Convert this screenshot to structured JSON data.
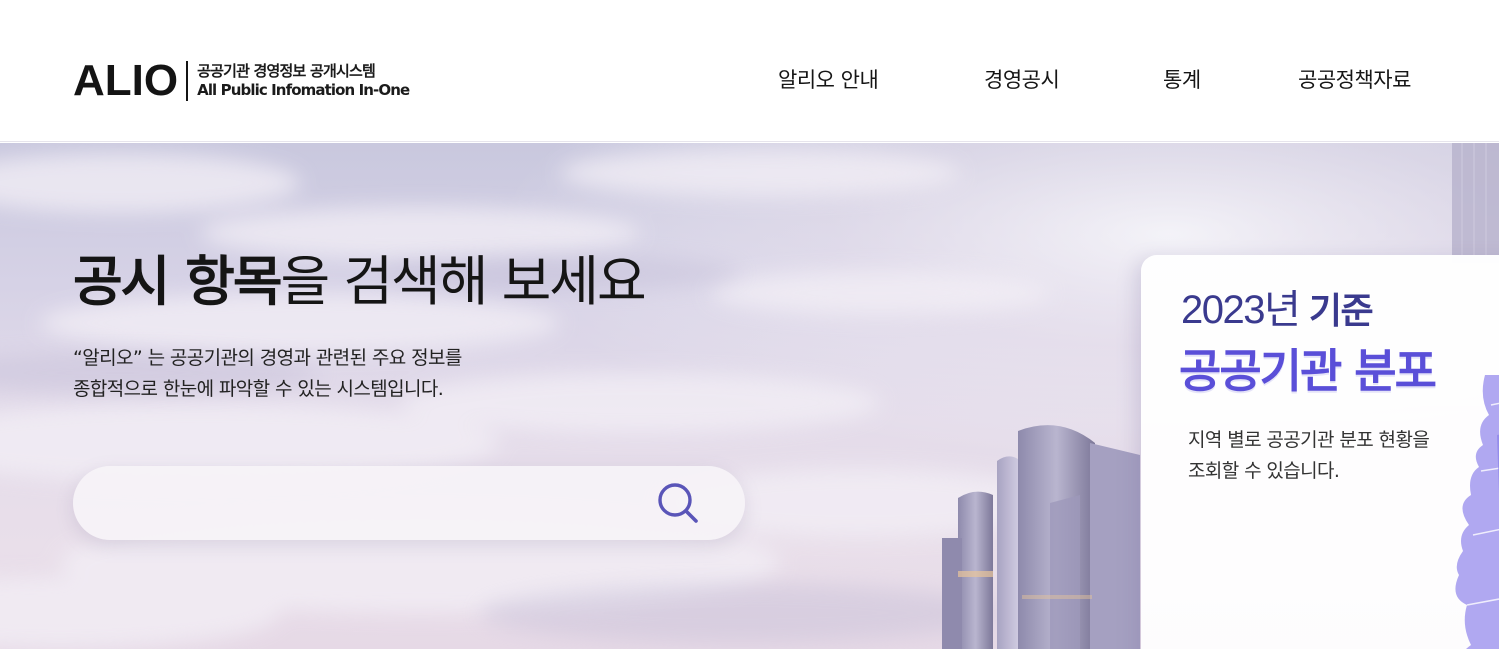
{
  "header": {
    "logo": {
      "mark": "ALIO",
      "korean": "공공기관 경영정보 공개시스템",
      "english": "All Public Infomation In-One"
    },
    "nav": [
      {
        "label": "알리오 안내"
      },
      {
        "label": "경영공시"
      },
      {
        "label": "통계"
      },
      {
        "label": "공공정책자료"
      }
    ]
  },
  "hero": {
    "title_bold": "공시 항목",
    "title_rest": "을 검색해 보세요",
    "description_line1": "“알리오” 는 공공기관의 경영과 관련된 주요 정보를",
    "description_line2": "종합적으로 한눈에 파악할 수 있는 시스템입니다.",
    "search": {
      "placeholder": "",
      "value": "",
      "icon": "search-icon"
    }
  },
  "card": {
    "year": "2023년",
    "year_suffix": "기준",
    "headline": "공공기관 분포",
    "description_line1": "지역 별로 공공기관 분포 현황을",
    "description_line2": "조회할 수 있습니다."
  },
  "colors": {
    "accent": "#5a4fd8",
    "card_year": "#3a3a8e",
    "text_dark": "#151515",
    "search_icon": "#5a55b8"
  }
}
